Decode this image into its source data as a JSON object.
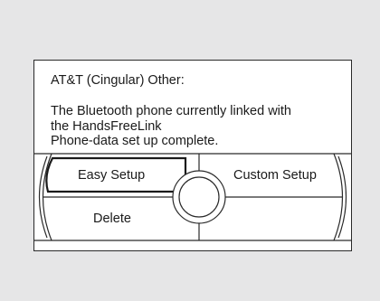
{
  "dialog": {
    "title": "AT&T (Cingular) Other:",
    "message_lines": [
      "The Bluetooth phone currently linked with",
      "the HandsFreeLink",
      "Phone-data set up complete."
    ]
  },
  "buttons": {
    "easy_setup": "Easy Setup",
    "custom_setup": "Custom Setup",
    "delete": "Delete"
  },
  "selected": "Easy Setup"
}
